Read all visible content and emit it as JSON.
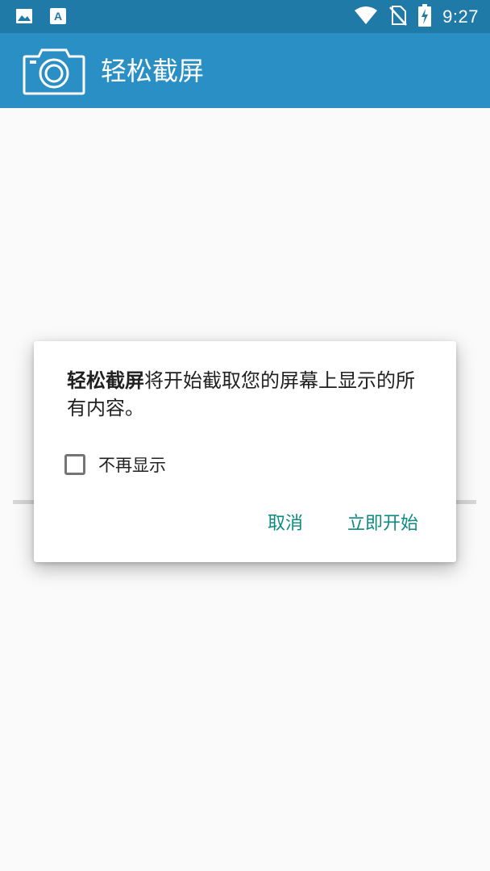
{
  "status_bar": {
    "time": "9:27",
    "icons": [
      "gallery-icon",
      "text-app-icon",
      "wifi-icon",
      "no-sim-icon",
      "battery-charging-icon"
    ]
  },
  "app_bar": {
    "title": "轻松截屏",
    "logo_icon": "camera-icon",
    "background_color": "#2a8fc5",
    "status_color": "#1f7aa8"
  },
  "dialog": {
    "app_name": "轻松截屏",
    "message": "将开始截取您的屏幕上显示的所有内容。",
    "checkbox_label": "不再显示",
    "checkbox_checked": false,
    "cancel_label": "取消",
    "start_label": "立即开始",
    "button_color": "#0d8a80"
  }
}
